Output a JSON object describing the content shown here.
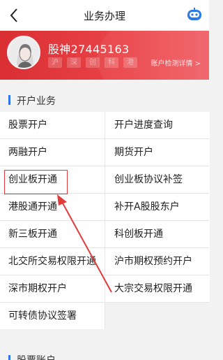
{
  "header": {
    "title": "业务办理",
    "back_icon": "chevron-left-icon",
    "assistant_icon": "robot-icon"
  },
  "profile": {
    "username": "股神27445163",
    "markets": [
      "沪",
      "深",
      "创",
      "科",
      "港"
    ],
    "detect_link": "账户检测详情 >"
  },
  "sections": [
    {
      "title": "开户业务",
      "items": [
        "股票开户",
        "开户进度查询",
        "两融开户",
        "期货开户",
        "创业板开通",
        "创业板协议补签",
        "港股通开通",
        "补开A股股东户",
        "新三板开通",
        "科创板开通",
        "北交所交易权限开通",
        "沪市期权预约开户",
        "深市期权开户",
        "大宗交易权限开通",
        "可转债协议签署"
      ]
    },
    {
      "title": "股票账户"
    }
  ],
  "colors": {
    "banner": "#e23b40",
    "accent_bar": "#2f74e8",
    "highlight": "#e33a3a"
  }
}
